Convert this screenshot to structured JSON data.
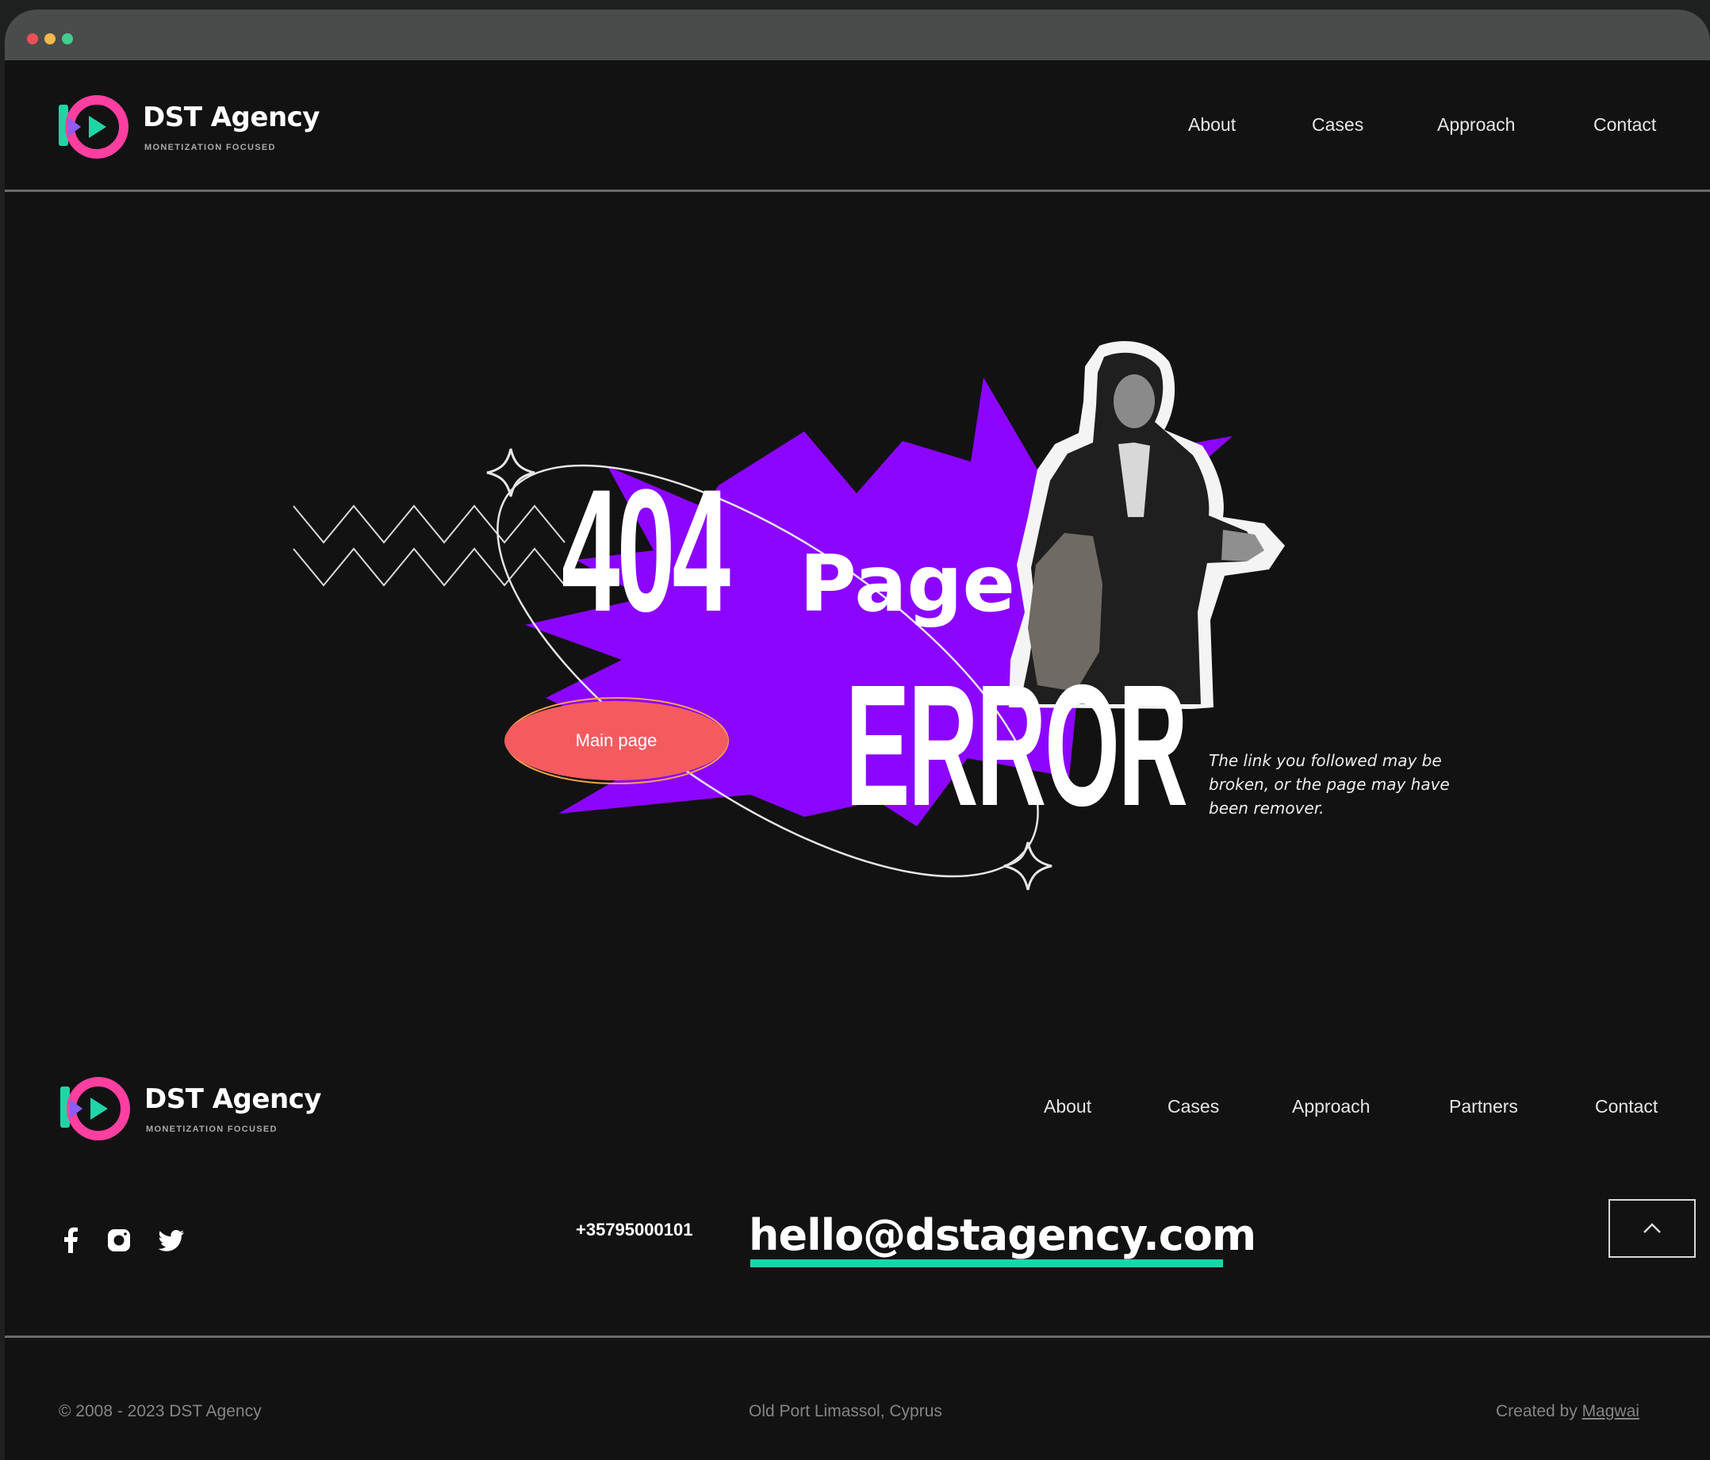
{
  "brand": {
    "name": "DST Agency",
    "tagline": "Monetization focused"
  },
  "header": {
    "nav": [
      "About",
      "Cases",
      "Approach",
      "Contact"
    ]
  },
  "hero": {
    "code": "404",
    "page_word": "Page",
    "error_word": "ERROR",
    "button_label": "Main page",
    "description": "The link you followed may be broken, or the page may have been remover."
  },
  "footer": {
    "nav": [
      "About",
      "Cases",
      "Approach",
      "Partners",
      "Contact"
    ],
    "social_icons": [
      "facebook-icon",
      "instagram-icon",
      "twitter-icon"
    ],
    "phone": "+35795000101",
    "email": "hello@dstagency.com",
    "copyright": "© 2008 - 2023 DST Agency",
    "address": "Old Port Limassol, Cyprus",
    "credit_prefix": "Created by ",
    "credit_name": "Magwai"
  },
  "colors": {
    "background": "#121213",
    "accent_purple": "#8c06ff",
    "button_coral": "#f45b5f",
    "underline_teal": "#1bd5a9",
    "dot_red": "#ec4f59",
    "dot_yellow": "#f2b84b",
    "dot_green": "#3fcf8e"
  }
}
